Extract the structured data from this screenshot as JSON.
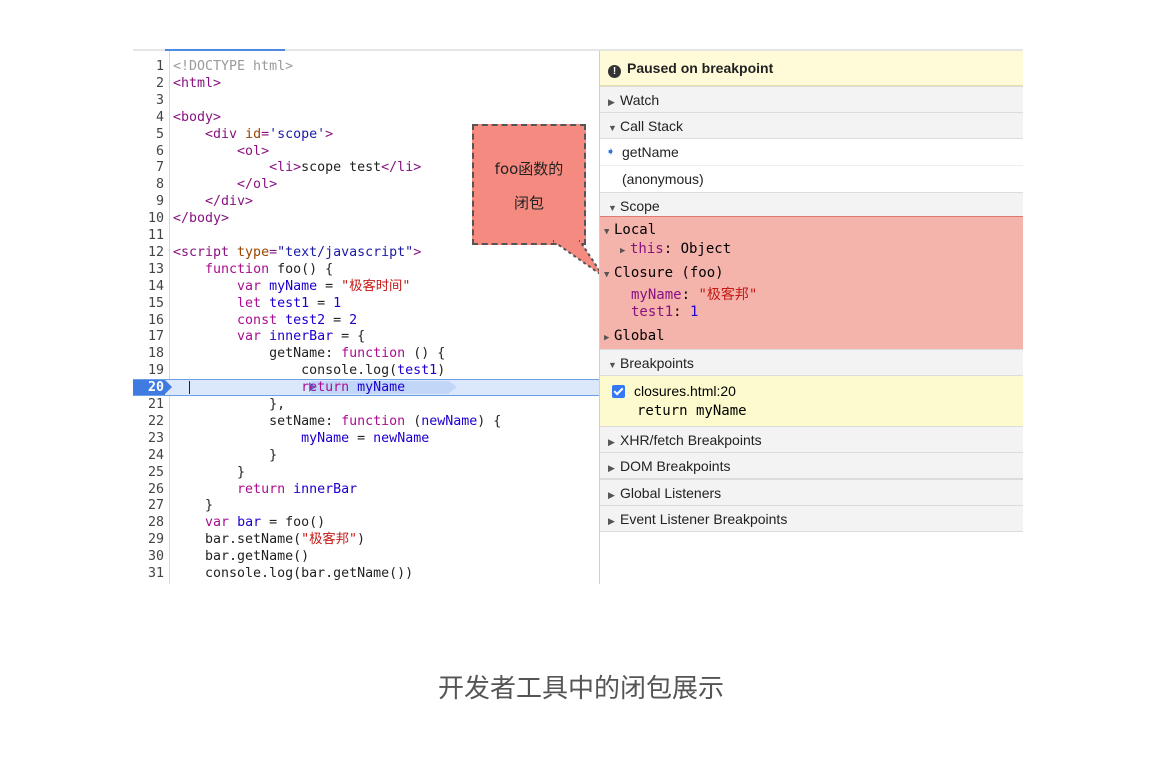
{
  "editor": {
    "lines": [
      {
        "n": "1",
        "parts": [
          [
            "t-c",
            "<!DOCTYPE html>"
          ]
        ]
      },
      {
        "n": "2",
        "parts": [
          [
            "t-tag",
            "<html>"
          ]
        ]
      },
      {
        "n": "3",
        "parts": []
      },
      {
        "n": "4",
        "parts": [
          [
            "t-tag",
            "<body>"
          ]
        ]
      },
      {
        "n": "5",
        "parts": [
          [
            "t-def",
            "    "
          ],
          [
            "t-tag",
            "<div "
          ],
          [
            "t-attr",
            "id"
          ],
          [
            "t-tag",
            "="
          ],
          [
            "t-str",
            "'scope'"
          ],
          [
            "t-tag",
            ">"
          ]
        ]
      },
      {
        "n": "6",
        "parts": [
          [
            "t-def",
            "        "
          ],
          [
            "t-tag",
            "<ol>"
          ]
        ]
      },
      {
        "n": "7",
        "parts": [
          [
            "t-def",
            "            "
          ],
          [
            "t-tag",
            "<li>"
          ],
          [
            "t-def",
            "scope test"
          ],
          [
            "t-tag",
            "</li>"
          ]
        ]
      },
      {
        "n": "8",
        "parts": [
          [
            "t-def",
            "        "
          ],
          [
            "t-tag",
            "</ol>"
          ]
        ]
      },
      {
        "n": "9",
        "parts": [
          [
            "t-def",
            "    "
          ],
          [
            "t-tag",
            "</div>"
          ]
        ]
      },
      {
        "n": "10",
        "parts": [
          [
            "t-tag",
            "</body>"
          ]
        ]
      },
      {
        "n": "11",
        "parts": []
      },
      {
        "n": "12",
        "parts": [
          [
            "t-tag",
            "<script "
          ],
          [
            "t-attr",
            "type"
          ],
          [
            "t-tag",
            "="
          ],
          [
            "t-str",
            "\"text/javascript\""
          ],
          [
            "t-tag",
            ">"
          ]
        ]
      },
      {
        "n": "13",
        "parts": [
          [
            "t-def",
            "    "
          ],
          [
            "t-kw",
            "function "
          ],
          [
            "t-def",
            "foo() {"
          ]
        ]
      },
      {
        "n": "14",
        "parts": [
          [
            "t-def",
            "        "
          ],
          [
            "t-kw",
            "var "
          ],
          [
            "t-name",
            "myName"
          ],
          [
            "t-def",
            " = "
          ],
          [
            "t-red",
            "\"极客时间\""
          ]
        ]
      },
      {
        "n": "15",
        "parts": [
          [
            "t-def",
            "        "
          ],
          [
            "t-kw",
            "let "
          ],
          [
            "t-name",
            "test1"
          ],
          [
            "t-def",
            " = "
          ],
          [
            "t-num",
            "1"
          ]
        ]
      },
      {
        "n": "16",
        "parts": [
          [
            "t-def",
            "        "
          ],
          [
            "t-kw",
            "const "
          ],
          [
            "t-name",
            "test2"
          ],
          [
            "t-def",
            " = "
          ],
          [
            "t-num",
            "2"
          ]
        ]
      },
      {
        "n": "17",
        "parts": [
          [
            "t-def",
            "        "
          ],
          [
            "t-kw",
            "var "
          ],
          [
            "t-name",
            "innerBar"
          ],
          [
            "t-def",
            " = {"
          ]
        ]
      },
      {
        "n": "18",
        "parts": [
          [
            "t-def",
            "            getName: "
          ],
          [
            "t-kw",
            "function "
          ],
          [
            "t-def",
            "() {"
          ]
        ]
      },
      {
        "n": "19",
        "parts": [
          [
            "t-def",
            "                console.log("
          ],
          [
            "t-name",
            "test1"
          ],
          [
            "t-def",
            ")"
          ]
        ]
      },
      {
        "n": "20",
        "parts": [
          [
            "t-def",
            "                "
          ],
          [
            "t-kw",
            "return "
          ],
          [
            "t-name",
            "myName"
          ]
        ],
        "active": true
      },
      {
        "n": "21",
        "parts": [
          [
            "t-def",
            "            },"
          ]
        ]
      },
      {
        "n": "22",
        "parts": [
          [
            "t-def",
            "            setName: "
          ],
          [
            "t-kw",
            "function "
          ],
          [
            "t-def",
            "("
          ],
          [
            "t-name",
            "newName"
          ],
          [
            "t-def",
            ") {"
          ]
        ]
      },
      {
        "n": "23",
        "parts": [
          [
            "t-def",
            "                "
          ],
          [
            "t-name",
            "myName"
          ],
          [
            "t-def",
            " = "
          ],
          [
            "t-name",
            "newName"
          ]
        ]
      },
      {
        "n": "24",
        "parts": [
          [
            "t-def",
            "            }"
          ]
        ]
      },
      {
        "n": "25",
        "parts": [
          [
            "t-def",
            "        }"
          ]
        ]
      },
      {
        "n": "26",
        "parts": [
          [
            "t-def",
            "        "
          ],
          [
            "t-kw",
            "return "
          ],
          [
            "t-name",
            "innerBar"
          ]
        ]
      },
      {
        "n": "27",
        "parts": [
          [
            "t-def",
            "    }"
          ]
        ]
      },
      {
        "n": "28",
        "parts": [
          [
            "t-def",
            "    "
          ],
          [
            "t-kw",
            "var "
          ],
          [
            "t-name",
            "bar"
          ],
          [
            "t-def",
            " = foo()"
          ]
        ]
      },
      {
        "n": "29",
        "parts": [
          [
            "t-def",
            "    bar.setName("
          ],
          [
            "t-red",
            "\"极客邦\""
          ],
          [
            "t-def",
            ")"
          ]
        ]
      },
      {
        "n": "30",
        "parts": [
          [
            "t-def",
            "    bar.getName()"
          ]
        ]
      },
      {
        "n": "31",
        "parts": [
          [
            "t-def",
            "    console.log(bar.getName())"
          ]
        ]
      }
    ]
  },
  "callout": {
    "line1": "foo函数的",
    "line2": "闭包"
  },
  "sidebar": {
    "paused": "Paused on breakpoint",
    "watch": "Watch",
    "call_stack": "Call Stack",
    "frames": [
      "getName",
      "(anonymous)"
    ],
    "scope": "Scope",
    "scope_items": {
      "local": "Local",
      "this_key": "this",
      "this_val": "Object",
      "closure": "Closure (foo)",
      "myname_key": "myName",
      "myname_val": "\"极客邦\"",
      "test1_key": "test1",
      "test1_val": "1",
      "global": "Global"
    },
    "breakpoints": "Breakpoints",
    "bp_file": "closures.html:20",
    "bp_code": "return myName",
    "xhr": "XHR/fetch Breakpoints",
    "dom": "DOM Breakpoints",
    "global_listeners": "Global Listeners",
    "event_listener": "Event Listener Breakpoints"
  },
  "caption": "开发者工具中的闭包展示"
}
